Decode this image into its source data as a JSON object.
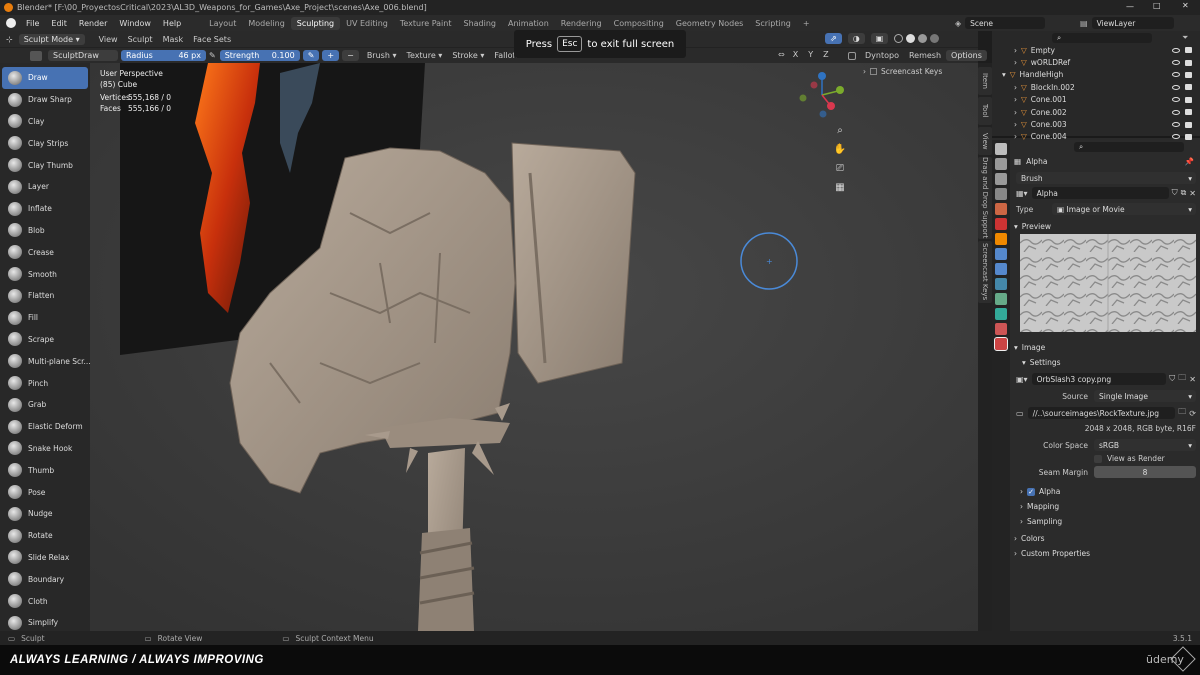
{
  "title_bar": {
    "text": "Blender* [F:\\00_ProyectosCritical\\2023\\AL3D_Weapons_for_Games\\Axe_Project\\scenes\\Axe_006.blend]"
  },
  "menu": [
    "File",
    "Edit",
    "Render",
    "Window",
    "Help"
  ],
  "workspaces": {
    "items": [
      "Layout",
      "Modeling",
      "Sculpting",
      "UV Editing",
      "Texture Paint",
      "Shading",
      "Animation",
      "Rendering",
      "Compositing",
      "Geometry Nodes",
      "Scripting"
    ],
    "active": "Sculpting",
    "add": "+"
  },
  "scene": {
    "label": "Scene",
    "viewlayer": "ViewLayer"
  },
  "header": {
    "mode": "Sculpt Mode",
    "items": [
      "View",
      "Sculpt",
      "Mask",
      "Face Sets"
    ]
  },
  "tool_settings": {
    "brush": "SculptDraw",
    "radius_label": "Radius",
    "radius_value": "46 px",
    "strength_label": "Strength",
    "strength_value": "0.100",
    "menus": [
      "Brush",
      "Texture",
      "Stroke",
      "Falloff",
      "Cursor"
    ],
    "axes": [
      "X",
      "Y",
      "Z"
    ],
    "dyntopo": "Dyntopo",
    "remesh": "Remesh",
    "options": "Options"
  },
  "toast": {
    "press": "Press",
    "key": "Esc",
    "rest": "to exit full screen"
  },
  "viewport_info": {
    "perspective": "User Perspective",
    "object": "(85) Cube",
    "vertices_label": "Vertices",
    "vertices_value": "555,168 / 0",
    "faces_label": "Faces",
    "faces_value": "555,166 / 0"
  },
  "screencast": "Screencast Keys",
  "tools": [
    "Draw",
    "Draw Sharp",
    "Clay",
    "Clay Strips",
    "Clay Thumb",
    "Layer",
    "Inflate",
    "Blob",
    "Crease",
    "Smooth",
    "Flatten",
    "Fill",
    "Scrape",
    "Multi-plane Scr...",
    "Pinch",
    "Grab",
    "Elastic Deform",
    "Snake Hook",
    "Thumb",
    "Pose",
    "Nudge",
    "Rotate",
    "Slide Relax",
    "Boundary",
    "Cloth",
    "Simplify"
  ],
  "active_tool": "Draw",
  "side_tabs": [
    "Item",
    "Tool",
    "View",
    "Drag and Drop Support",
    "Screencast Keys"
  ],
  "outliner": [
    {
      "name": "Empty",
      "indent": 1
    },
    {
      "name": "wORLDRef",
      "indent": 1
    },
    {
      "name": "HandleHigh",
      "indent": 0
    },
    {
      "name": "BlockIn.002",
      "indent": 1
    },
    {
      "name": "Cone.001",
      "indent": 1
    },
    {
      "name": "Cone.002",
      "indent": 1
    },
    {
      "name": "Cone.003",
      "indent": 1
    },
    {
      "name": "Cone.004",
      "indent": 1
    }
  ],
  "properties": {
    "header": "Alpha",
    "brush_label": "Brush",
    "texture_name": "Alpha",
    "type_label": "Type",
    "type_value": "Image or Movie",
    "preview_label": "Preview",
    "image_label": "Image",
    "settings_label": "Settings",
    "image_file": "OrbSlash3 copy.png",
    "source_label": "Source",
    "source_value": "Single Image",
    "filepath": "//..\\sourceimages\\RockTexture.jpg",
    "image_info": "2048 x 2048,  RGB byte,  R16F",
    "colorspace_label": "Color Space",
    "colorspace_value": "sRGB",
    "view_as_render": "View as Render",
    "seam_margin_label": "Seam Margin",
    "seam_margin_value": "8",
    "alpha_label": "Alpha",
    "mapping_label": "Mapping",
    "sampling_label": "Sampling",
    "colors_label": "Colors",
    "custom_props_label": "Custom Properties"
  },
  "status": {
    "left": "Sculpt",
    "middle": "Rotate View",
    "right": "Sculpt Context Menu",
    "version": "3.5.1"
  },
  "brand": {
    "tagline": "ALWAYS LEARNING / ALWAYS IMPROVING",
    "logo": "ūdemy"
  },
  "colors": {
    "accent": "#4772b3",
    "sculpt": "#a8998a"
  }
}
